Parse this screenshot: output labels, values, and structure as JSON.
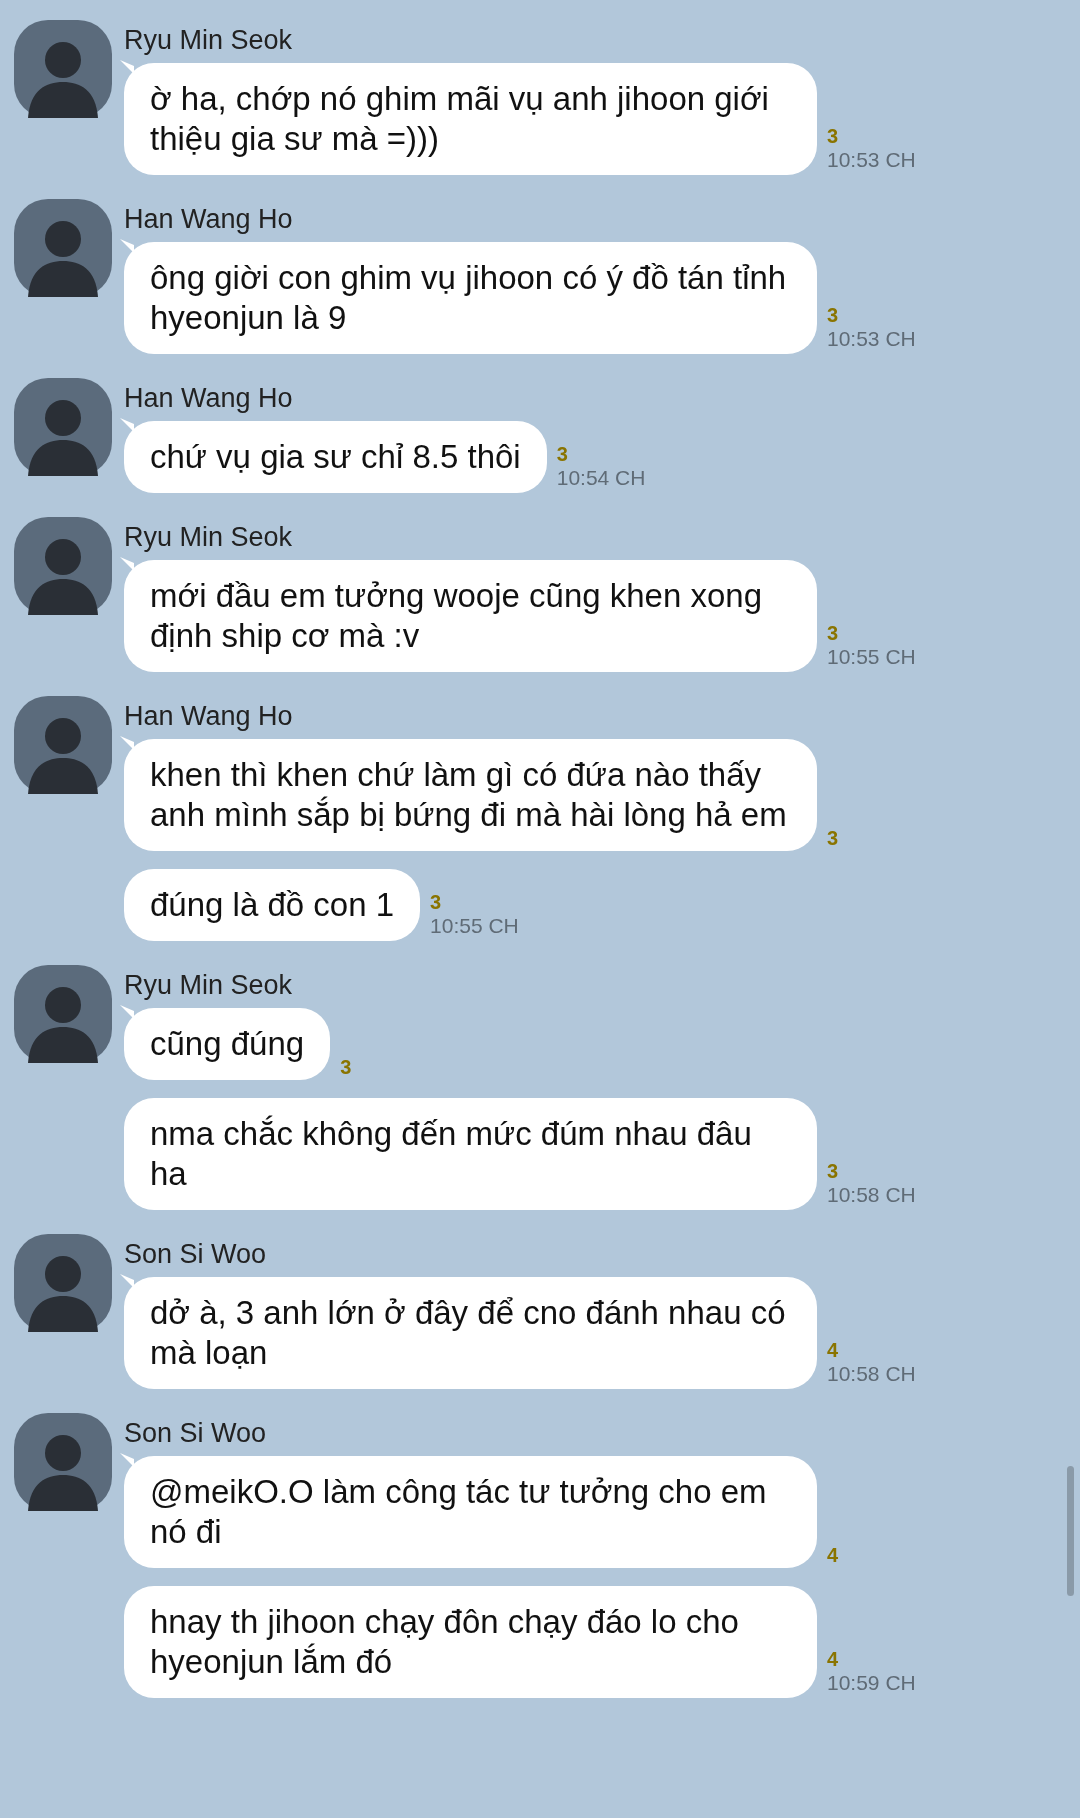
{
  "groups": [
    {
      "sender": "Ryu Min Seok",
      "messages": [
        {
          "text": "ờ ha, chớp nó ghim mãi vụ anh jihoon giới thiệu gia sư mà =)))",
          "read_count": "3",
          "time": "10:53 CH"
        }
      ]
    },
    {
      "sender": "Han Wang Ho",
      "messages": [
        {
          "text": "ông giời con ghim vụ  jihoon có ý đồ tán tỉnh hyeonjun là 9",
          "read_count": "3",
          "time": "10:53 CH"
        }
      ]
    },
    {
      "sender": "Han Wang Ho",
      "messages": [
        {
          "text": "chứ vụ gia sư chỉ 8.5 thôi",
          "read_count": "3",
          "time": "10:54 CH"
        }
      ]
    },
    {
      "sender": "Ryu Min Seok",
      "messages": [
        {
          "text": "mới đầu em tưởng wooje cũng khen xong định ship cơ mà :v",
          "read_count": "3",
          "time": "10:55 CH"
        }
      ]
    },
    {
      "sender": "Han Wang Ho",
      "messages": [
        {
          "text": "khen thì khen chứ làm gì có đứa nào thấy anh mình sắp bị bứng đi mà hài lòng hả em",
          "read_count": "3"
        },
        {
          "text": "đúng là đồ con 1",
          "read_count": "3",
          "time": "10:55 CH"
        }
      ]
    },
    {
      "sender": "Ryu Min Seok",
      "messages": [
        {
          "text": "cũng đúng",
          "read_count": "3"
        },
        {
          "text": "nma chắc không đến mức đúm nhau đâu ha",
          "read_count": "3",
          "time": "10:58 CH"
        }
      ]
    },
    {
      "sender": "Son Si Woo",
      "messages": [
        {
          "text": "dở à, 3 anh lớn ở đây để cno đánh nhau có mà loạn",
          "read_count": "4",
          "time": "10:58 CH"
        }
      ]
    },
    {
      "sender": "Son Si Woo",
      "messages": [
        {
          "text": "@meikO.O làm công tác tư tưởng cho em nó đi",
          "read_count": "4"
        },
        {
          "text": "hnay th jihoon chạy đôn chạy đáo lo cho hyeonjun lắm đó",
          "read_count": "4",
          "time": "10:59 CH"
        }
      ]
    }
  ]
}
